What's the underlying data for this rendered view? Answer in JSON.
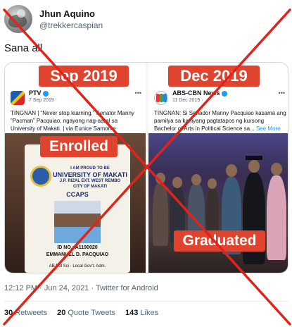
{
  "author": {
    "display_name": "Jhun Aquino",
    "handle": "@trekkercaspian"
  },
  "tweet": {
    "text": "Sana all",
    "timestamp": "12:12 PM · Jun 24, 2021 · Twitter for Android",
    "stats": {
      "retweets_count": "30",
      "retweets_label": "Retweets",
      "quotes_count": "20",
      "quotes_label": "Quote Tweets",
      "likes_count": "143",
      "likes_label": "Likes"
    }
  },
  "media": {
    "left": {
      "banner": "Sep 2019",
      "source_name": "PTV",
      "source_date": "7 Sep 2019 ·",
      "caption": "TINGNAN | “Never stop learning.” Senator Manny “Pacman” Pacquiao, ngayong nag-aaral sa University of Makati. | via Eunice Samonte",
      "tag": "Enrolled",
      "id_card": {
        "line1": "I AM PROUD TO BE",
        "line2": "UNIVERSITY OF MAKATI",
        "line3": "J.P. RIZAL EXT. WEST REMBO",
        "line4": "CITY OF MAKATI",
        "dept": "CCAPS",
        "id_no": "ID NO.: A1190020",
        "name": "EMMANUEL D. PACQUIAO",
        "course": "AB Pol Sci - Local Gov't. Adm."
      }
    },
    "right": {
      "banner": "Dec 2019",
      "source_name": "ABS-CBN News",
      "source_date": "11 Dec 2019 ·",
      "caption": "TINGNAN: Si Senador Manny Pacquiao kasama ang pamilya sa kaniyang pagtatapos ng kursong Bachelor of Arts in Political Science sa...",
      "see_more": "See More",
      "tag": "Graduated"
    }
  },
  "colors": {
    "banner_red": "#e0442e",
    "cross_red": "#e0241b",
    "link_blue": "#1d9bf0"
  },
  "icons": {
    "verified": "verified-badge-icon",
    "more": "more-dots-icon"
  }
}
